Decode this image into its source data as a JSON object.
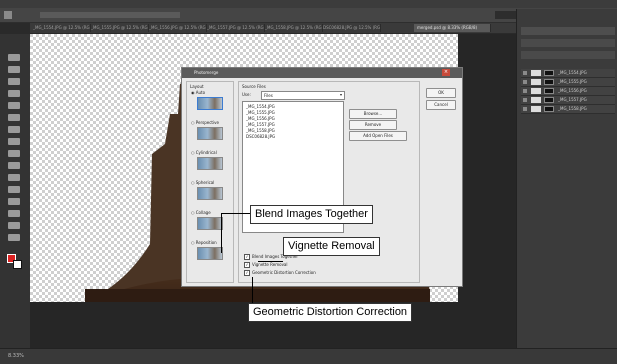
{
  "photoshop": {
    "tabs": [
      "_MG_1554.JPG @ 12.5% (RG...",
      "_MG_1555.JPG @ 12.5% (RG...",
      "_MG_1556.JPG @ 12.5% (RG...",
      "_MG_1557.JPG @ 12.5% (RG...",
      "_MG_1558.JPG @ 12.5% (RG...",
      "DSC06828.JPG @ 12.5% (RG...",
      "merged.psd @ 8.33% (RGB/8)"
    ],
    "layers": [
      "_MG_1554.JPG",
      "_MG_1555.JPG",
      "_MG_1556.JPG",
      "_MG_1557.JPG",
      "_MG_1558.JPG"
    ],
    "status_zoom": "8.33%"
  },
  "dialog": {
    "title": "Photomerge",
    "layout_header": "Layout",
    "layouts": [
      "Auto",
      "Perspective",
      "Cylindrical",
      "Spherical",
      "Collage",
      "Reposition"
    ],
    "source_header": "Source Files",
    "use_label": "Use:",
    "use_value": "Files",
    "files": [
      "_MG_1554.JPG",
      "_MG_1555.JPG",
      "_MG_1556.JPG",
      "_MG_1557.JPG",
      "_MG_1558.JPG",
      "DSC06828.JPG"
    ],
    "browse_button": "Browse...",
    "remove_button": "Remove",
    "add_open_button": "Add Open Files",
    "ok_button": "OK",
    "cancel_button": "Cancel",
    "checkbox_blend": "Blend Images Together",
    "checkbox_vignette": "Vignette Removal",
    "checkbox_geometric": "Geometric Distortion Correction"
  },
  "callouts": {
    "blend": "Blend Images Together",
    "vignette": "Vignette Removal",
    "geometric": "Geometric Distortion Correction"
  }
}
